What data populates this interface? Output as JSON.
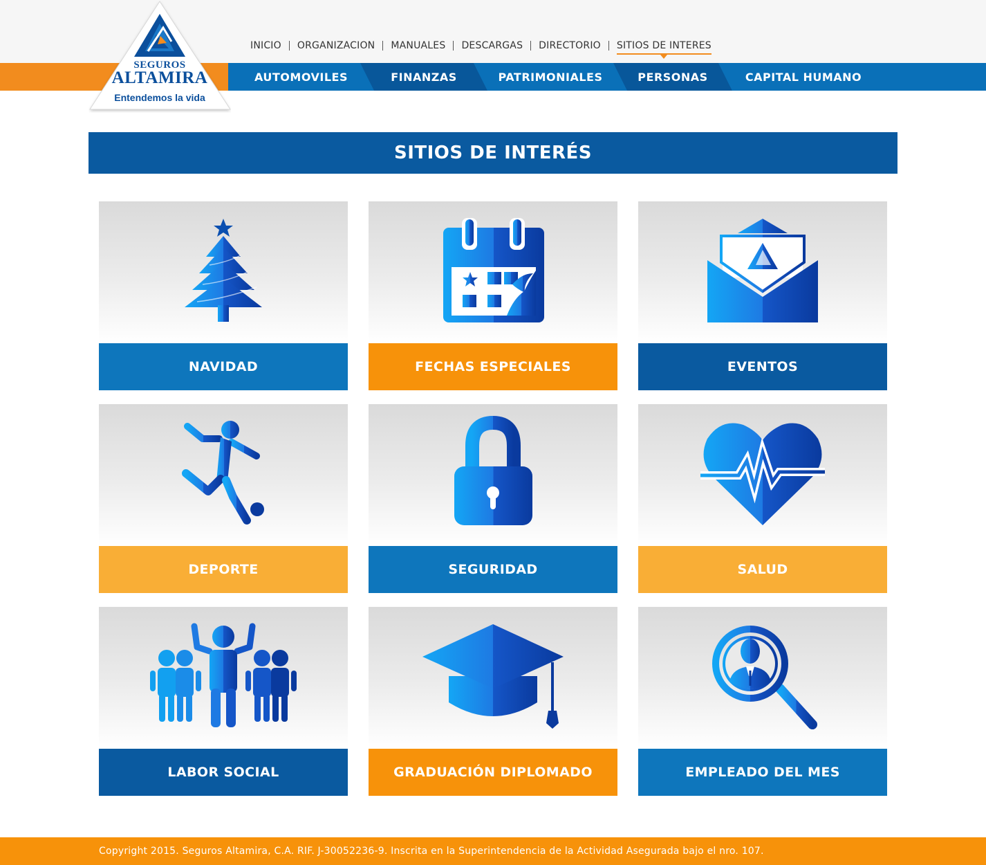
{
  "brand": {
    "name_top": "SEGUROS",
    "name_main": "ALTAMIRA",
    "tagline": "Entendemos la vida",
    "colors": {
      "primary_blue": "#0a70b8",
      "dark_blue": "#0a5aa0",
      "orange": "#f7920a",
      "light_orange": "#f9ae36"
    }
  },
  "top_nav": [
    {
      "label": "INICIO"
    },
    {
      "label": "ORGANIZACION"
    },
    {
      "label": "MANUALES"
    },
    {
      "label": "DESCARGAS"
    },
    {
      "label": "DIRECTORIO"
    },
    {
      "label": "SITIOS DE INTERES",
      "active": true
    }
  ],
  "category_nav": [
    {
      "label": "AUTOMOVILES"
    },
    {
      "label": "FINANZAS"
    },
    {
      "label": "PATRIMONIALES"
    },
    {
      "label": "PERSONAS"
    },
    {
      "label": "CAPITAL HUMANO"
    }
  ],
  "page_title": "SITIOS DE INTERÉS",
  "tiles": [
    {
      "label": "NAVIDAD",
      "icon": "christmas-tree-icon",
      "color": "#0e76bc"
    },
    {
      "label": "FECHAS ESPECIALES",
      "icon": "calendar-icon",
      "color": "#f7920a"
    },
    {
      "label": "EVENTOS",
      "icon": "envelope-icon",
      "color": "#0a5aa0"
    },
    {
      "label": "DEPORTE",
      "icon": "soccer-player-icon",
      "color": "#f9ae36"
    },
    {
      "label": "SEGURIDAD",
      "icon": "padlock-icon",
      "color": "#0e76bc"
    },
    {
      "label": "SALUD",
      "icon": "heart-pulse-icon",
      "color": "#f9ae36"
    },
    {
      "label": "LABOR SOCIAL",
      "icon": "people-group-icon",
      "color": "#0a5aa0"
    },
    {
      "label": "GRADUACIÓN DIPLOMADO",
      "icon": "graduation-cap-icon",
      "color": "#f7920a"
    },
    {
      "label": "EMPLEADO DEL MES",
      "icon": "employee-search-icon",
      "color": "#0e76bc"
    }
  ],
  "footer": {
    "text": "Copyright 2015. Seguros Altamira, C.A. RIF. J-30052236-9. Inscrita en la Superintendencia de la Actividad Asegurada bajo el nro. 107."
  }
}
